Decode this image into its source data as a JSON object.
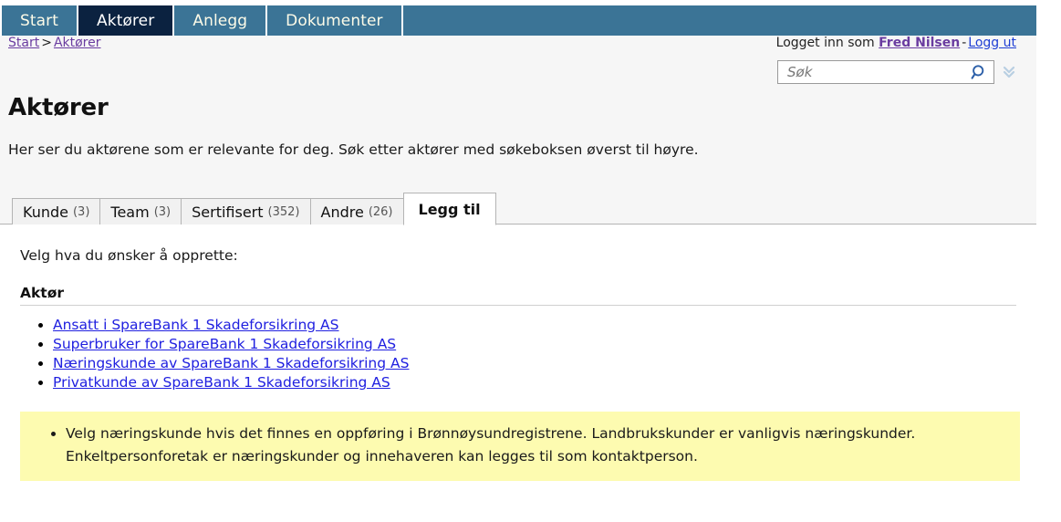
{
  "nav": {
    "items": [
      {
        "label": "Start",
        "active": false
      },
      {
        "label": "Aktører",
        "active": true
      },
      {
        "label": "Anlegg",
        "active": false
      },
      {
        "label": "Dokumenter",
        "active": false
      }
    ]
  },
  "breadcrumb": {
    "items": [
      "Start",
      "Aktører"
    ],
    "separator": ">"
  },
  "account": {
    "prefix": "Logget inn som",
    "user": "Fred Nilsen",
    "dash": "-",
    "logout": "Logg ut"
  },
  "search": {
    "placeholder": "Søk",
    "value": "",
    "search_icon": "magnifier-icon",
    "expand_icon": "double-chevron-down-icon"
  },
  "page": {
    "title": "Aktører",
    "intro": "Her ser du aktørene som er relevante for deg. Søk etter aktører med søkeboksen øverst til høyre."
  },
  "tabs": [
    {
      "label": "Kunde",
      "count": "(3)",
      "active": false
    },
    {
      "label": "Team",
      "count": "(3)",
      "active": false
    },
    {
      "label": "Sertifisert",
      "count": "(352)",
      "active": false
    },
    {
      "label": "Andre",
      "count": "(26)",
      "active": false
    },
    {
      "label": "Legg til",
      "count": "",
      "active": true
    }
  ],
  "panel": {
    "choose_label": "Velg hva du ønsker å opprette:",
    "section_heading": "Aktør",
    "links": [
      "Ansatt i SpareBank 1 Skadeforsikring AS",
      "Superbruker for SpareBank 1 Skadeforsikring AS",
      "Næringskunde av SpareBank 1 Skadeforsikring AS",
      "Privatkunde av SpareBank 1 Skadeforsikring AS"
    ],
    "notice": [
      "Velg næringskunde hvis det finnes en oppføring i Brønnøysundregistrene. Landbrukskunder er vanligvis næringskunder. Enkeltpersonforetak er næringskunder og innehaveren kan legges til som kontaktperson."
    ]
  },
  "colors": {
    "nav_bg": "#3b7496",
    "nav_active_bg": "#0b2240",
    "link_blue": "#2020e0",
    "visited_purple": "#6a3ca0",
    "notice_yellow": "#fdfbb0",
    "page_bg": "#f6f6f6"
  }
}
